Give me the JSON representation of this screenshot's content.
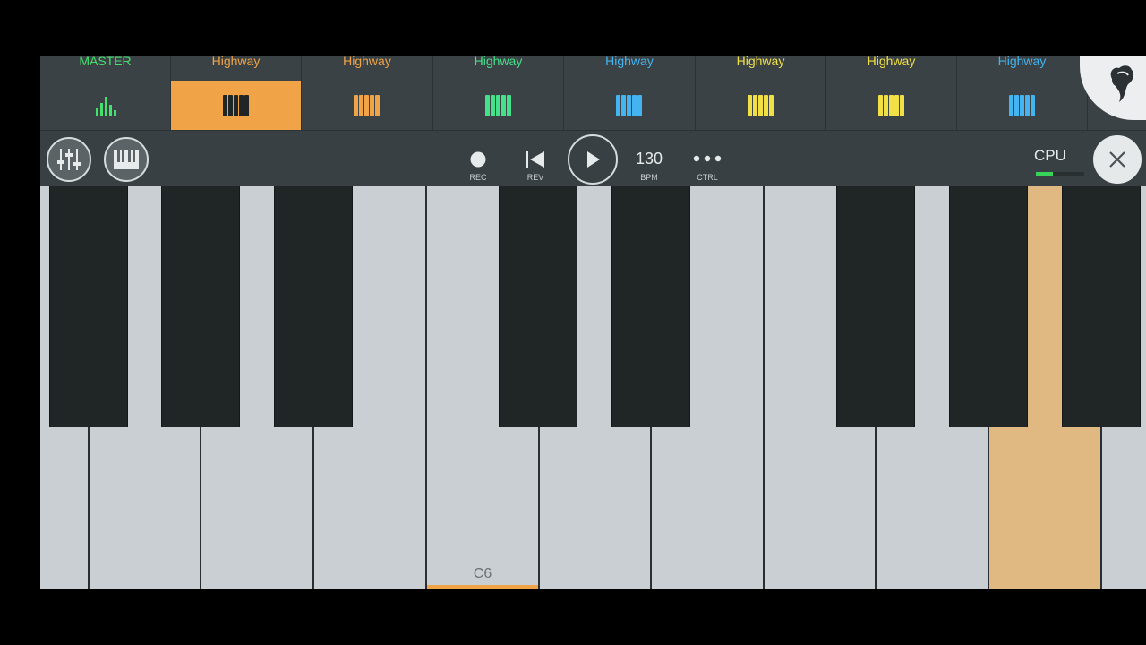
{
  "channels": [
    {
      "name": "MASTER",
      "color": "#45e06d",
      "icon": "mixer-meter-icon",
      "selected": false
    },
    {
      "name": "Highway",
      "color": "#f0a447",
      "icon": "keyboard-icon",
      "selected": true
    },
    {
      "name": "Highway",
      "color": "#f0a447",
      "icon": "keyboard-icon",
      "selected": false
    },
    {
      "name": "Highway",
      "color": "#45e08a",
      "icon": "keyboard-icon",
      "selected": false
    },
    {
      "name": "Highway",
      "color": "#43b4f0",
      "icon": "keyboard-icon",
      "selected": false
    },
    {
      "name": "Highway",
      "color": "#f0e046",
      "icon": "keyboard-icon",
      "selected": false
    },
    {
      "name": "Highway",
      "color": "#f0e046",
      "icon": "keyboard-icon",
      "selected": false
    },
    {
      "name": "Highway",
      "color": "#43b4f0",
      "icon": "keyboard-icon",
      "selected": false
    }
  ],
  "toolbar": {
    "mixer_icon": "mixer-sliders-icon",
    "piano_icon": "piano-icon",
    "rec_label": "REC",
    "rev_label": "REV",
    "bpm_value": "130",
    "bpm_label": "BPM",
    "ctrl_label": "CTRL",
    "cpu_label": "CPU",
    "cpu_load": 0.35
  },
  "keyboard": {
    "octave_label": "C6",
    "active_key": "A6",
    "accent_color": "#f0a447",
    "highlight_color": "#dfb981"
  }
}
